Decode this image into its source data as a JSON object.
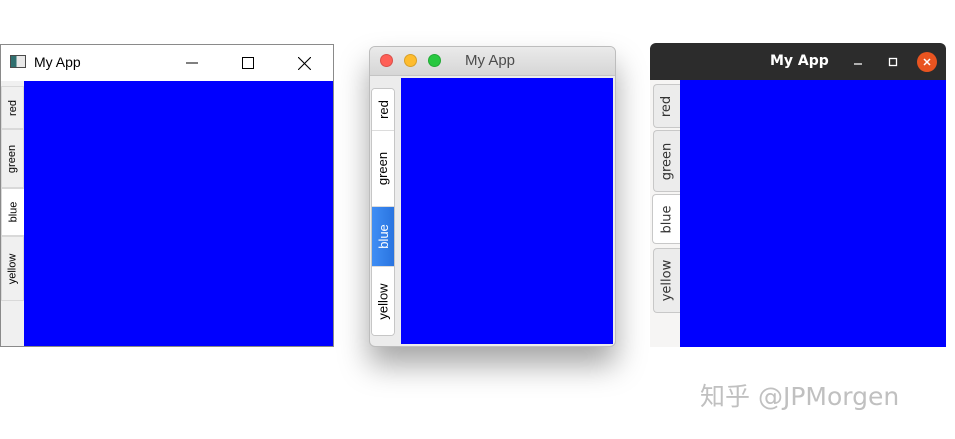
{
  "pane_color": "#0000ff",
  "tabs": [
    "red",
    "green",
    "blue",
    "yellow"
  ],
  "selected_tab": "blue",
  "windows": {
    "win": {
      "title": "My App",
      "controls": [
        "minimize-icon",
        "maximize-icon",
        "close-icon"
      ]
    },
    "mac": {
      "title": "My App",
      "traffic_lights": {
        "close": "#ff5f57",
        "minimize": "#febc2e",
        "zoom": "#28c840"
      },
      "accent": "#2f80ed"
    },
    "ubuntu": {
      "title": "My App",
      "close_color": "#e95420",
      "controls": [
        "minimize-icon",
        "maximize-icon",
        "close-icon"
      ]
    }
  },
  "watermark": "知乎 @JPMorgen"
}
